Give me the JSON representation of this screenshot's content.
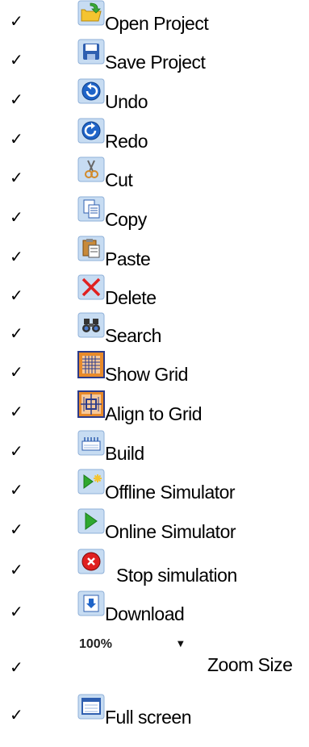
{
  "check_mark": "✓",
  "items": [
    {
      "label": "Open Project",
      "icon": "open-folder-icon"
    },
    {
      "label": "Save Project",
      "icon": "save-disk-icon"
    },
    {
      "label": "Undo",
      "icon": "undo-icon"
    },
    {
      "label": "Redo",
      "icon": "redo-icon"
    },
    {
      "label": "Cut",
      "icon": "scissors-icon"
    },
    {
      "label": "Copy",
      "icon": "copy-icon"
    },
    {
      "label": "Paste",
      "icon": "paste-icon"
    },
    {
      "label": "Delete",
      "icon": "delete-x-icon"
    },
    {
      "label": "Search",
      "icon": "binoculars-icon"
    },
    {
      "label": "Show Grid",
      "icon": "grid-icon"
    },
    {
      "label": "Align to Grid",
      "icon": "align-grid-icon"
    },
    {
      "label": "Build",
      "icon": "build-icon"
    },
    {
      "label": "Offline Simulator",
      "icon": "offline-play-icon"
    },
    {
      "label": "Online Simulator",
      "icon": "play-icon"
    },
    {
      "label": "Stop simulation",
      "icon": "stop-icon"
    },
    {
      "label": "Download",
      "icon": "download-icon"
    },
    {
      "label": "Zoom Size",
      "icon": "zoom-dropdown",
      "zoom_value": "100%"
    },
    {
      "label": "Full screen",
      "icon": "full-screen-icon"
    }
  ],
  "colors": {
    "icon_bg": "#c7dcf2",
    "icon_border": "#8fb0d8",
    "folder_yellow": "#f4c430",
    "green_arrow": "#3aa935",
    "blue_disk": "#2f5fb0",
    "blue_circle": "#1f64c8",
    "red": "#e02020",
    "grid_orange": "#e88a2a",
    "play_green": "#2fa82f"
  }
}
